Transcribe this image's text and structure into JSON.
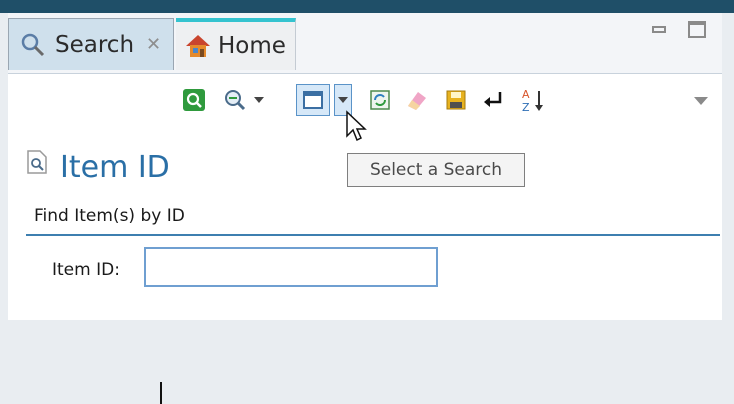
{
  "tabs": {
    "search": {
      "label": "Search",
      "icon": "search-magnifier-icon"
    },
    "home": {
      "label": "Home",
      "icon": "home-icon"
    }
  },
  "toolbar": {
    "icons": [
      "execute-search-icon",
      "find-icon",
      "select-search-icon",
      "refresh-icon",
      "clear-icon",
      "save-icon",
      "return-icon",
      "sort-icon"
    ]
  },
  "form": {
    "title": "Item ID",
    "subtitle": "Find Item(s) by ID",
    "field_label": "Item ID:",
    "field_value": ""
  },
  "tooltip": "Select a Search",
  "colors": {
    "title_blue": "#2a6fa6",
    "separator_blue": "#3d7fb0",
    "tab_active": "#cfe0ec",
    "home_tab_accent": "#34c3cf"
  }
}
